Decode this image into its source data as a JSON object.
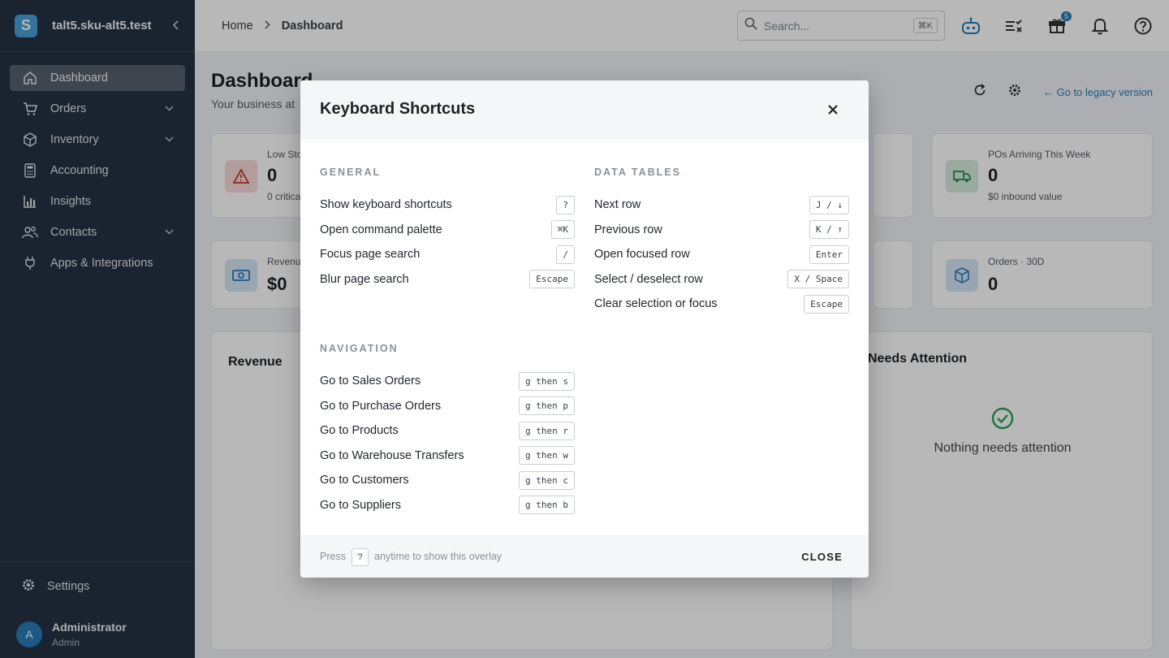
{
  "sidebar": {
    "brand": "talt5.sku-alt5.test",
    "logo_letter": "S",
    "items": [
      {
        "label": "Dashboard",
        "icon": "home-icon",
        "active": true,
        "expandable": false
      },
      {
        "label": "Orders",
        "icon": "cart-icon",
        "expandable": true
      },
      {
        "label": "Inventory",
        "icon": "box-icon",
        "expandable": true
      },
      {
        "label": "Accounting",
        "icon": "calculator-icon",
        "expandable": false
      },
      {
        "label": "Insights",
        "icon": "chart-icon",
        "expandable": false
      },
      {
        "label": "Contacts",
        "icon": "people-icon",
        "expandable": true
      },
      {
        "label": "Apps & Integrations",
        "icon": "plug-icon",
        "expandable": false
      }
    ],
    "settings_label": "Settings",
    "user": {
      "initial": "A",
      "name": "Administrator",
      "role": "Admin"
    }
  },
  "topbar": {
    "breadcrumbs": [
      "Home",
      "Dashboard"
    ],
    "search_placeholder": "Search...",
    "search_shortcut": "⌘K",
    "notification_badge": "5"
  },
  "page": {
    "title": "Dashboard",
    "subtitle": "Your business at",
    "legacy_link": "Go to legacy version",
    "kpis": [
      {
        "label": "Low Sto",
        "value": "0",
        "sub": "0 critica"
      },
      {
        "label": "POs Arriving This Week",
        "value": "0",
        "sub": "$0 inbound value"
      },
      {
        "label": "Revenu",
        "value": "$0",
        "sub": ""
      },
      {
        "label": "Orders · 30D",
        "value": "0",
        "sub": ""
      }
    ],
    "revenue_panel_title": "Revenue",
    "attention_panel_title": "Needs Attention",
    "attention_empty": "Nothing needs attention"
  },
  "modal": {
    "title": "Keyboard Shortcuts",
    "general": {
      "heading": "GENERAL",
      "rows": [
        {
          "label": "Show keyboard shortcuts",
          "key": "?"
        },
        {
          "label": "Open command palette",
          "key": "⌘K"
        },
        {
          "label": "Focus page search",
          "key": "/"
        },
        {
          "label": "Blur page search",
          "key": "Escape"
        }
      ]
    },
    "data_tables": {
      "heading": "DATA TABLES",
      "rows": [
        {
          "label": "Next row",
          "key": "J / ↓"
        },
        {
          "label": "Previous row",
          "key": "K / ↑"
        },
        {
          "label": "Open focused row",
          "key": "Enter"
        },
        {
          "label": "Select / deselect row",
          "key": "X / Space"
        },
        {
          "label": "Clear selection or focus",
          "key": "Escape"
        }
      ]
    },
    "navigation": {
      "heading": "NAVIGATION",
      "rows": [
        {
          "label": "Go to Sales Orders",
          "key": "g then s"
        },
        {
          "label": "Go to Purchase Orders",
          "key": "g then p"
        },
        {
          "label": "Go to Products",
          "key": "g then r"
        },
        {
          "label": "Go to Warehouse Transfers",
          "key": "g then w"
        },
        {
          "label": "Go to Customers",
          "key": "g then c"
        },
        {
          "label": "Go to Suppliers",
          "key": "g then b"
        }
      ]
    },
    "footer": {
      "press": "Press",
      "key": "?",
      "rest": "anytime to show this overlay",
      "close_label": "CLOSE"
    }
  }
}
